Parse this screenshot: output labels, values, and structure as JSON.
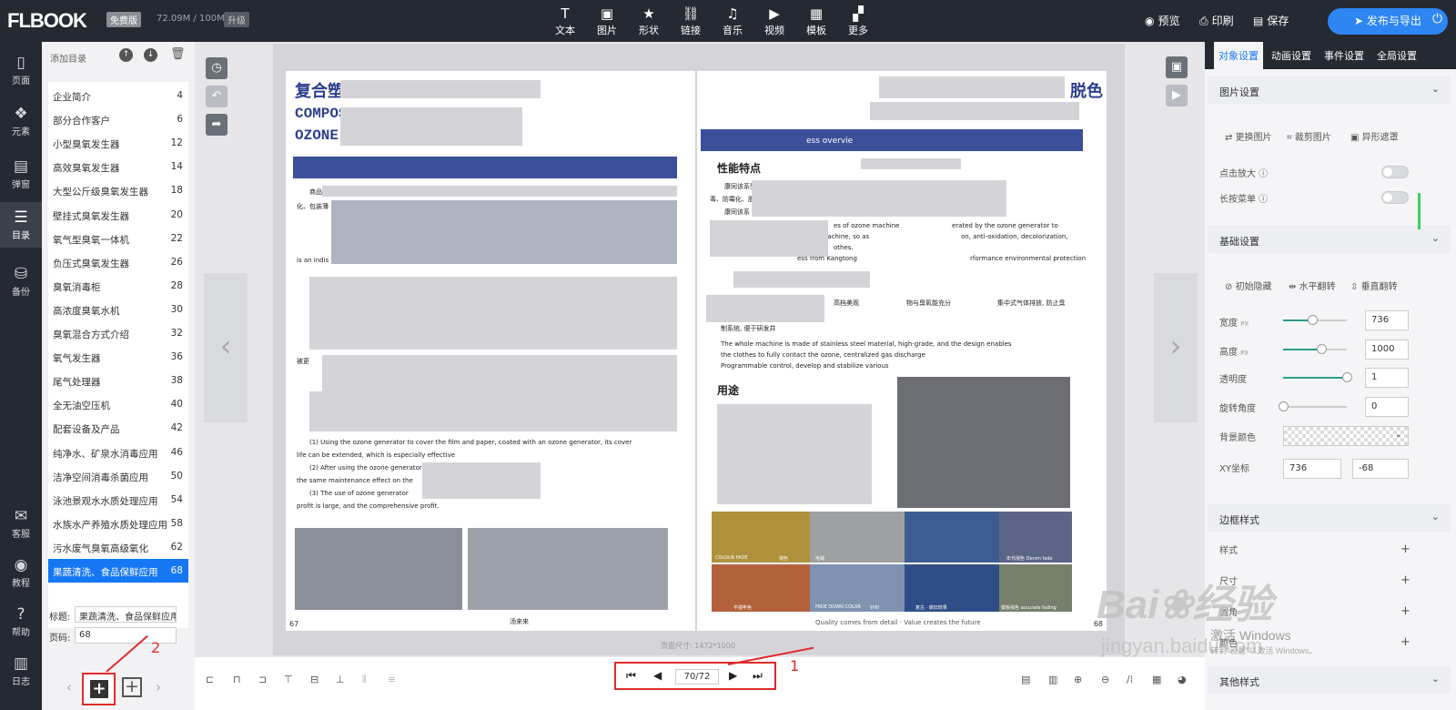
{
  "app": {
    "logo": "FLBOOK",
    "edition_badge": "免费版",
    "storage": "72.09M / 100M",
    "upgrade_label": "升级"
  },
  "toolbar": {
    "tools": [
      {
        "label": "文本",
        "icon": "text-icon"
      },
      {
        "label": "图片",
        "icon": "image-icon"
      },
      {
        "label": "形状",
        "icon": "shape-icon"
      },
      {
        "label": "链接",
        "icon": "link-icon"
      },
      {
        "label": "音乐",
        "icon": "music-icon"
      },
      {
        "label": "视频",
        "icon": "video-icon"
      },
      {
        "label": "模板",
        "icon": "template-icon"
      },
      {
        "label": "更多",
        "icon": "more-icon"
      }
    ],
    "preview": "预览",
    "print": "印刷",
    "save": "保存",
    "publish": "发布与导出"
  },
  "left_rail": [
    {
      "label": "页面",
      "icon": "page-icon"
    },
    {
      "label": "元素",
      "icon": "element-icon"
    },
    {
      "label": "弹窗",
      "icon": "popup-icon"
    },
    {
      "label": "目录",
      "icon": "toc-icon",
      "active": true
    },
    {
      "label": "备份",
      "icon": "backup-icon"
    },
    {
      "label": "客服",
      "icon": "support-icon"
    },
    {
      "label": "教程",
      "icon": "tutorial-icon"
    },
    {
      "label": "帮助",
      "icon": "help-icon"
    },
    {
      "label": "日志",
      "icon": "log-icon"
    }
  ],
  "toc": {
    "header": "添加目录",
    "items": [
      {
        "name": "企业简介",
        "page": "4"
      },
      {
        "name": "部分合作客户",
        "page": "6"
      },
      {
        "name": "小型臭氧发生器",
        "page": "12"
      },
      {
        "name": "高效臭氧发生器",
        "page": "14"
      },
      {
        "name": "大型公斤级臭氧发生器",
        "page": "18"
      },
      {
        "name": "壁挂式臭氧发生器",
        "page": "20"
      },
      {
        "name": "氧气型臭氧一体机",
        "page": "22"
      },
      {
        "name": "负压式臭氧发生器",
        "page": "26"
      },
      {
        "name": "臭氧消毒柜",
        "page": "28"
      },
      {
        "name": "高浓度臭氧水机",
        "page": "30"
      },
      {
        "name": "臭氧混合方式介绍",
        "page": "32"
      },
      {
        "name": "氧气发生器",
        "page": "36"
      },
      {
        "name": "尾气处理器",
        "page": "38"
      },
      {
        "name": "全无油空压机",
        "page": "40"
      },
      {
        "name": "配套设备及产品",
        "page": "42"
      },
      {
        "name": "纯净水、矿泉水消毒应用",
        "page": "46"
      },
      {
        "name": "洁净空间消毒杀菌应用",
        "page": "50"
      },
      {
        "name": "泳池景观水水质处理应用",
        "page": "54"
      },
      {
        "name": "水族水产养殖水质处理应用",
        "page": "58"
      },
      {
        "name": "污水废气臭氧高级氧化",
        "page": "62"
      },
      {
        "name": "果蔬清洗、食品保鲜应用",
        "page": "68",
        "selected": true
      }
    ],
    "title_label": "标题:",
    "title_value": "果蔬清洗、食品保鲜应用",
    "page_label": "页码:",
    "page_value": "68"
  },
  "book": {
    "left_title": "复合塑料薄膜臭氧化工艺",
    "left_sub1": "COMPOSITE PLASTIC FILM",
    "left_sub2": "OZONE PROCESS",
    "left_page_num": "67",
    "right_title_end": "脱色",
    "right_band": "ess overvie",
    "right_section1": "性能特点",
    "right_section2": "用途",
    "right_footer": "Quality comes from detail · Value creates the future",
    "right_page_num": "68",
    "left_body": [
      "商品包装",
      "化、包装薄",
      "is an indis",
      "被更",
      "(1) Using the ozone generator to cover the film and paper, coated with an ozone generator, its cover",
      "life can be extended, which is especially effective",
      "(2) After using the ozone generator, to be damaged, can have",
      "the same maintenance effect on the",
      "(3) The use of ozone generator",
      "profit is large, and the comprehensive profit."
    ],
    "right_body": [
      "康同该系列臭氧机工作原理是利用臭",
      "毒、防霉化、脱色、国色",
      "康同该系 具有极高的",
      "es of ozone machine",
      "erated by the ozone generator to",
      "e machine, so as",
      "on, anti-oxidation, decolorization,",
      "othes.",
      "ess from Kangtong",
      "rformance environmental protection",
      "高档美观",
      "物与臭氧能充分",
      "集中式气体排放, 防止臭",
      "制系统, 便于研发并",
      "The whole machine is made of stainless steel material, high-grade, and the design enables",
      "the clothes to fully contact the ozone, centralized gas discharge",
      "Programmable control, develop and stabilize various"
    ],
    "image_labels": [
      "COLOUR FADE",
      "褪色",
      "毛绒",
      "年代褪色 Denim fade",
      "不褪牢色",
      "FADE DOWN COLOR",
      "针织",
      "复古 · 做旧效果",
      "模板褪色 accurate fading"
    ],
    "left_caption": "汤来来"
  },
  "pager": {
    "current": "70/72",
    "page_size": "页面尺寸: 1472*1000"
  },
  "right_panel": {
    "tabs": [
      "对象设置",
      "动画设置",
      "事件设置",
      "全局设置"
    ],
    "image_settings": "图片设置",
    "replace_image": "更换图片",
    "crop_image": "裁剪图片",
    "shape_mask": "异形遮罩",
    "click_zoom": "点击放大",
    "long_press_menu": "长按菜单",
    "basic_settings": "基础设置",
    "initial_hidden": "初始隐藏",
    "flip_h": "水平翻转",
    "flip_v": "垂直翻转",
    "width_label": "宽度",
    "width_unit": "PX",
    "width_value": "736",
    "height_label": "高度",
    "height_unit": "PX",
    "height_value": "1000",
    "opacity_label": "透明度",
    "opacity_value": "1",
    "rotation_label": "旋转角度",
    "rotation_value": "0",
    "bg_color_label": "背景颜色",
    "xy_label": "XY坐标",
    "x_value": "736",
    "y_value": "-68",
    "border_style": "边框样式",
    "border_rows": [
      "样式",
      "尺寸",
      "圆角",
      "颜色"
    ],
    "other_style": "其他样式",
    "sliders": {
      "width": 0.45,
      "height": 0.6,
      "opacity": 1.0,
      "rotation": 0.0
    }
  },
  "annotations": {
    "one": "1",
    "two": "2"
  },
  "watermark": {
    "brand": "Bai",
    "brand_cn": "经验",
    "url": "jingyan.baidu.com",
    "activate": "激活 Windows",
    "activate_hint": "转到\"设置\"以激活 Windows。"
  },
  "colors": {
    "accent": "#1677f5",
    "topbar": "#252932",
    "publish": "#2d86f2",
    "annotation": "#e02b2b",
    "title": "#2b3f8e"
  }
}
